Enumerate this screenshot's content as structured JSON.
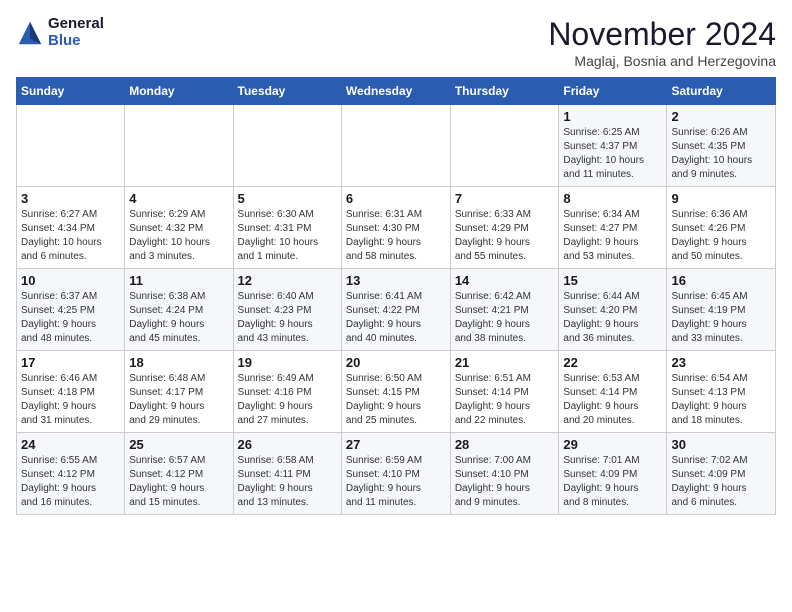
{
  "logo": {
    "general": "General",
    "blue": "Blue"
  },
  "header": {
    "month": "November 2024",
    "location": "Maglaj, Bosnia and Herzegovina"
  },
  "weekdays": [
    "Sunday",
    "Monday",
    "Tuesday",
    "Wednesday",
    "Thursday",
    "Friday",
    "Saturday"
  ],
  "weeks": [
    [
      {
        "day": "",
        "info": ""
      },
      {
        "day": "",
        "info": ""
      },
      {
        "day": "",
        "info": ""
      },
      {
        "day": "",
        "info": ""
      },
      {
        "day": "",
        "info": ""
      },
      {
        "day": "1",
        "info": "Sunrise: 6:25 AM\nSunset: 4:37 PM\nDaylight: 10 hours\nand 11 minutes."
      },
      {
        "day": "2",
        "info": "Sunrise: 6:26 AM\nSunset: 4:35 PM\nDaylight: 10 hours\nand 9 minutes."
      }
    ],
    [
      {
        "day": "3",
        "info": "Sunrise: 6:27 AM\nSunset: 4:34 PM\nDaylight: 10 hours\nand 6 minutes."
      },
      {
        "day": "4",
        "info": "Sunrise: 6:29 AM\nSunset: 4:32 PM\nDaylight: 10 hours\nand 3 minutes."
      },
      {
        "day": "5",
        "info": "Sunrise: 6:30 AM\nSunset: 4:31 PM\nDaylight: 10 hours\nand 1 minute."
      },
      {
        "day": "6",
        "info": "Sunrise: 6:31 AM\nSunset: 4:30 PM\nDaylight: 9 hours\nand 58 minutes."
      },
      {
        "day": "7",
        "info": "Sunrise: 6:33 AM\nSunset: 4:29 PM\nDaylight: 9 hours\nand 55 minutes."
      },
      {
        "day": "8",
        "info": "Sunrise: 6:34 AM\nSunset: 4:27 PM\nDaylight: 9 hours\nand 53 minutes."
      },
      {
        "day": "9",
        "info": "Sunrise: 6:36 AM\nSunset: 4:26 PM\nDaylight: 9 hours\nand 50 minutes."
      }
    ],
    [
      {
        "day": "10",
        "info": "Sunrise: 6:37 AM\nSunset: 4:25 PM\nDaylight: 9 hours\nand 48 minutes."
      },
      {
        "day": "11",
        "info": "Sunrise: 6:38 AM\nSunset: 4:24 PM\nDaylight: 9 hours\nand 45 minutes."
      },
      {
        "day": "12",
        "info": "Sunrise: 6:40 AM\nSunset: 4:23 PM\nDaylight: 9 hours\nand 43 minutes."
      },
      {
        "day": "13",
        "info": "Sunrise: 6:41 AM\nSunset: 4:22 PM\nDaylight: 9 hours\nand 40 minutes."
      },
      {
        "day": "14",
        "info": "Sunrise: 6:42 AM\nSunset: 4:21 PM\nDaylight: 9 hours\nand 38 minutes."
      },
      {
        "day": "15",
        "info": "Sunrise: 6:44 AM\nSunset: 4:20 PM\nDaylight: 9 hours\nand 36 minutes."
      },
      {
        "day": "16",
        "info": "Sunrise: 6:45 AM\nSunset: 4:19 PM\nDaylight: 9 hours\nand 33 minutes."
      }
    ],
    [
      {
        "day": "17",
        "info": "Sunrise: 6:46 AM\nSunset: 4:18 PM\nDaylight: 9 hours\nand 31 minutes."
      },
      {
        "day": "18",
        "info": "Sunrise: 6:48 AM\nSunset: 4:17 PM\nDaylight: 9 hours\nand 29 minutes."
      },
      {
        "day": "19",
        "info": "Sunrise: 6:49 AM\nSunset: 4:16 PM\nDaylight: 9 hours\nand 27 minutes."
      },
      {
        "day": "20",
        "info": "Sunrise: 6:50 AM\nSunset: 4:15 PM\nDaylight: 9 hours\nand 25 minutes."
      },
      {
        "day": "21",
        "info": "Sunrise: 6:51 AM\nSunset: 4:14 PM\nDaylight: 9 hours\nand 22 minutes."
      },
      {
        "day": "22",
        "info": "Sunrise: 6:53 AM\nSunset: 4:14 PM\nDaylight: 9 hours\nand 20 minutes."
      },
      {
        "day": "23",
        "info": "Sunrise: 6:54 AM\nSunset: 4:13 PM\nDaylight: 9 hours\nand 18 minutes."
      }
    ],
    [
      {
        "day": "24",
        "info": "Sunrise: 6:55 AM\nSunset: 4:12 PM\nDaylight: 9 hours\nand 16 minutes."
      },
      {
        "day": "25",
        "info": "Sunrise: 6:57 AM\nSunset: 4:12 PM\nDaylight: 9 hours\nand 15 minutes."
      },
      {
        "day": "26",
        "info": "Sunrise: 6:58 AM\nSunset: 4:11 PM\nDaylight: 9 hours\nand 13 minutes."
      },
      {
        "day": "27",
        "info": "Sunrise: 6:59 AM\nSunset: 4:10 PM\nDaylight: 9 hours\nand 11 minutes."
      },
      {
        "day": "28",
        "info": "Sunrise: 7:00 AM\nSunset: 4:10 PM\nDaylight: 9 hours\nand 9 minutes."
      },
      {
        "day": "29",
        "info": "Sunrise: 7:01 AM\nSunset: 4:09 PM\nDaylight: 9 hours\nand 8 minutes."
      },
      {
        "day": "30",
        "info": "Sunrise: 7:02 AM\nSunset: 4:09 PM\nDaylight: 9 hours\nand 6 minutes."
      }
    ]
  ]
}
